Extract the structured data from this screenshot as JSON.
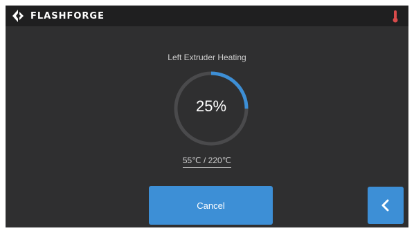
{
  "header": {
    "brand": "FLASHFORGE",
    "logo_icon": "flashforge-logo-icon",
    "status_icon": "thermometer-icon",
    "status_color": "#d94b4b"
  },
  "heating": {
    "title": "Left Extruder Heating",
    "progress_percent": 25,
    "progress_label": "25%",
    "temperature_readout": "55℃ / 220℃"
  },
  "actions": {
    "cancel_label": "Cancel",
    "back_icon": "chevron-left-icon"
  },
  "colors": {
    "accent": "#3d8fd6",
    "ring_track": "#4a4a4c",
    "background": "#2f2f30",
    "topbar": "#1f1f20"
  }
}
